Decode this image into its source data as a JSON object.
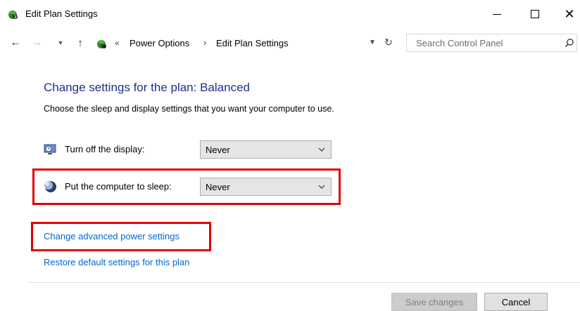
{
  "window": {
    "title": "Edit Plan Settings",
    "icon": "power-options-icon"
  },
  "nav": {
    "address_prefix": "«",
    "breadcrumbs": [
      "Power Options",
      "Edit Plan Settings"
    ],
    "separator": "›",
    "search_placeholder": "Search Control Panel"
  },
  "main": {
    "heading": "Change settings for the plan: Balanced",
    "subheading": "Choose the sleep and display settings that you want your computer to use.",
    "settings": [
      {
        "label": "Turn off the display:",
        "value": "Never",
        "icon": "display-clock-icon"
      },
      {
        "label": "Put the computer to sleep:",
        "value": "Never",
        "icon": "moon-sleep-icon"
      }
    ],
    "links": {
      "advanced": "Change advanced power settings",
      "restore": "Restore default settings for this plan"
    }
  },
  "footer": {
    "save_label": "Save changes",
    "cancel_label": "Cancel"
  },
  "colors": {
    "heading": "#1e3287",
    "link": "#0066cc",
    "highlight": "#e00000"
  }
}
